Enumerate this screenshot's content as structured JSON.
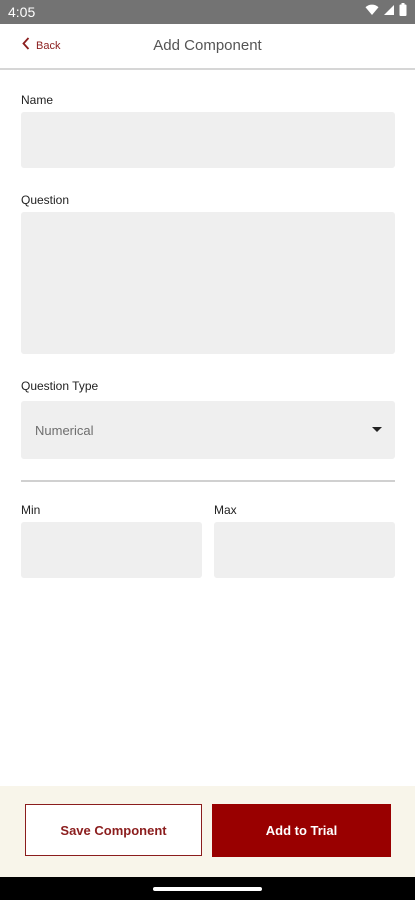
{
  "status_bar": {
    "time": "4:05",
    "icons": [
      "wifi-icon",
      "signal-icon",
      "battery-icon"
    ]
  },
  "header": {
    "back_label": "Back",
    "title": "Add Component"
  },
  "form": {
    "name": {
      "label": "Name",
      "value": ""
    },
    "question": {
      "label": "Question",
      "value": ""
    },
    "question_type": {
      "label": "Question Type",
      "value": "Numerical"
    },
    "min": {
      "label": "Min",
      "value": ""
    },
    "max": {
      "label": "Max",
      "value": ""
    }
  },
  "footer": {
    "save_label": "Save Component",
    "add_label": "Add to Trial"
  },
  "colors": {
    "accent": "#990000",
    "accent_text": "#8b1d1d",
    "field_bg": "#efefef",
    "footer_bg": "#f8f5ea",
    "status_bar_bg": "#737373"
  }
}
